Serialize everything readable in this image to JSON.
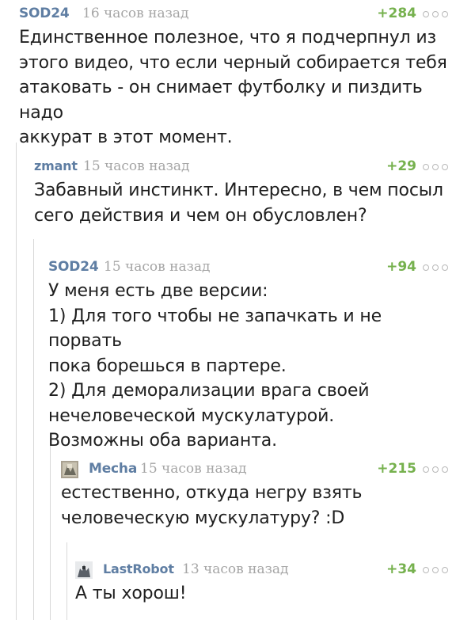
{
  "colors": {
    "author": "#5f7ea3",
    "time": "#a5a5a5",
    "rating": "#76b14e",
    "text": "#1f1f1f",
    "thread_line": "#d8d8d8"
  },
  "comments": [
    {
      "author": "SOD24",
      "time": "16 часов назад",
      "rating": "+284",
      "lines": [
        "Единственное полезное, что я подчерпнул из",
        "этого видео, что если черный собирается тебя",
        "атаковать - он снимает футболку и пиздить надо",
        "аккурат в этот момент."
      ]
    },
    {
      "author": "zmant",
      "time": "15 часов назад",
      "rating": "+29",
      "lines": [
        "Забавный инстинкт. Интересно, в чем посыл",
        "сего действия и чем он обусловлен?"
      ]
    },
    {
      "author": "SOD24",
      "time": "15 часов назад",
      "rating": "+94",
      "lines": [
        "У меня есть две версии:",
        "1) Для того чтобы не запачкать и не порвать",
        "пока борешься в партере.",
        "2) Для деморализации врага своей",
        "нечеловеческой мускулатурой.",
        "Возможны оба варианта."
      ]
    },
    {
      "author": "Mecha",
      "time": "15 часов назад",
      "rating": "+215",
      "avatar": "mecha-avatar",
      "lines": [
        "естественно, откуда негру взять",
        "человеческую мускулатуру? :D"
      ]
    },
    {
      "author": "LastRobot",
      "time": "13 часов назад",
      "rating": "+34",
      "avatar": "lastrobot-avatar",
      "lines": [
        "А ты хорош!"
      ]
    }
  ]
}
